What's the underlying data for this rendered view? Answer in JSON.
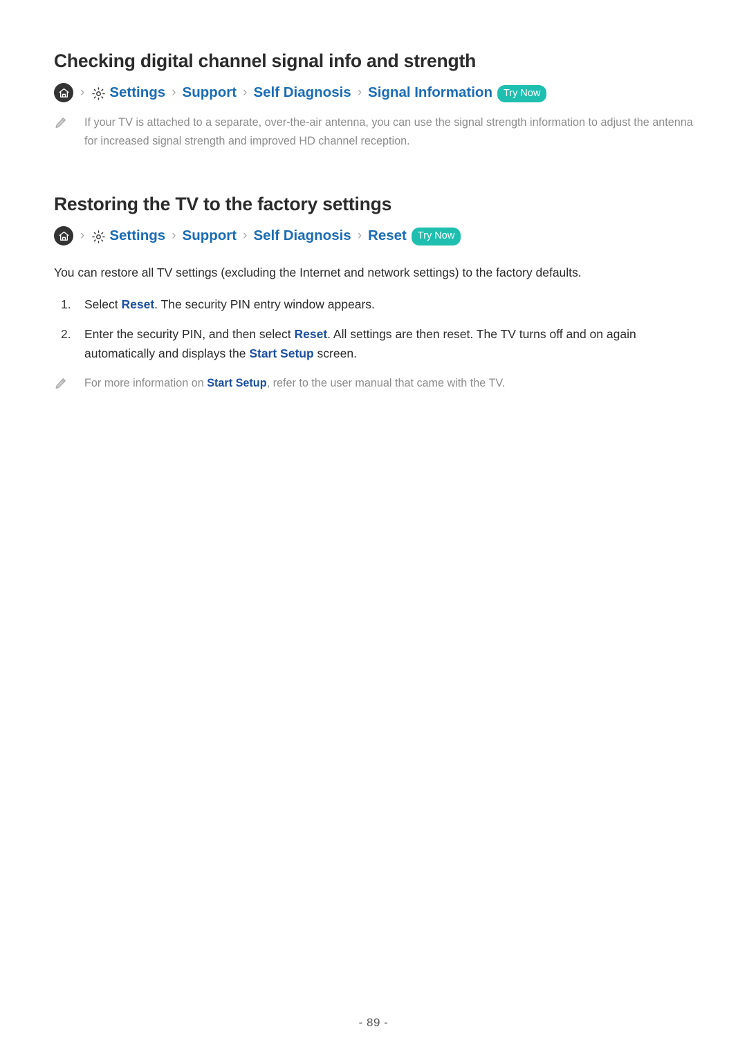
{
  "page": {
    "number_label": "- 89 -"
  },
  "sections": [
    {
      "title": "Checking digital channel signal info and strength",
      "breadcrumb": {
        "home_icon": "home-icon",
        "gear_icon": "gear-icon",
        "separator": "›",
        "crumbs": [
          "Settings",
          "Support",
          "Self Diagnosis",
          "Signal Information"
        ],
        "badge": "Try Now",
        "badge_color": "#1fbfb0",
        "link_color": "#1a6cb4"
      },
      "note": {
        "icon": "pencil-icon",
        "text": "If your TV is attached to a separate, over-the-air antenna, you can use the signal strength information to adjust the antenna for increased signal strength and improved HD channel reception."
      }
    },
    {
      "title": "Restoring the TV to the factory settings",
      "breadcrumb": {
        "home_icon": "home-icon",
        "gear_icon": "gear-icon",
        "separator": "›",
        "crumbs": [
          "Settings",
          "Support",
          "Self Diagnosis",
          "Reset"
        ],
        "badge": "Try Now",
        "badge_color": "#1fbfb0",
        "link_color": "#1a6cb4"
      },
      "intro": "You can restore all TV settings (excluding the Internet and network settings) to the factory defaults.",
      "steps": [
        {
          "marker": "1.",
          "before": "Select ",
          "link": "Reset",
          "after": ". The security PIN entry window appears."
        },
        {
          "marker": "2.",
          "before": "Enter the security PIN, and then select ",
          "link": "Reset",
          "mid": ". All settings are then reset. The TV turns off and on again automatically and displays the ",
          "link2": "Start Setup",
          "after": " screen."
        }
      ],
      "note": {
        "icon": "pencil-icon",
        "before": "For more information on ",
        "link": "Start Setup",
        "after": ", refer to the user manual that came with the TV."
      }
    }
  ]
}
